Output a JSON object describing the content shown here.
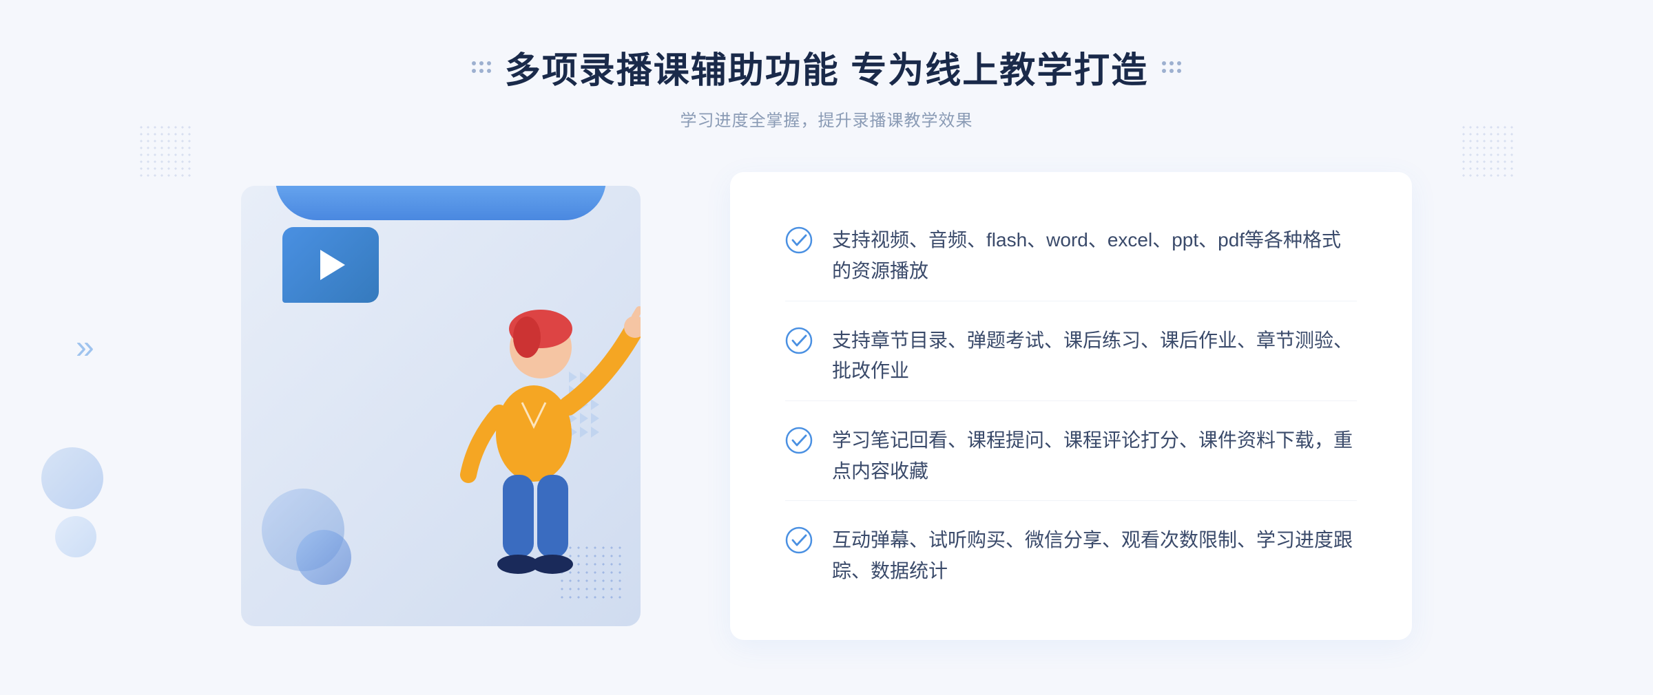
{
  "header": {
    "title": "多项录播课辅助功能 专为线上教学打造",
    "subtitle": "学习进度全掌握，提升录播课教学效果"
  },
  "features": [
    {
      "id": 1,
      "text": "支持视频、音频、flash、word、excel、ppt、pdf等各种格式的资源播放"
    },
    {
      "id": 2,
      "text": "支持章节目录、弹题考试、课后练习、课后作业、章节测验、批改作业"
    },
    {
      "id": 3,
      "text": "学习笔记回看、课程提问、课程评论打分、课件资料下载，重点内容收藏"
    },
    {
      "id": 4,
      "text": "互动弹幕、试听购买、微信分享、观看次数限制、学习进度跟踪、数据统计"
    }
  ],
  "decorative": {
    "chevron_left": "»"
  }
}
